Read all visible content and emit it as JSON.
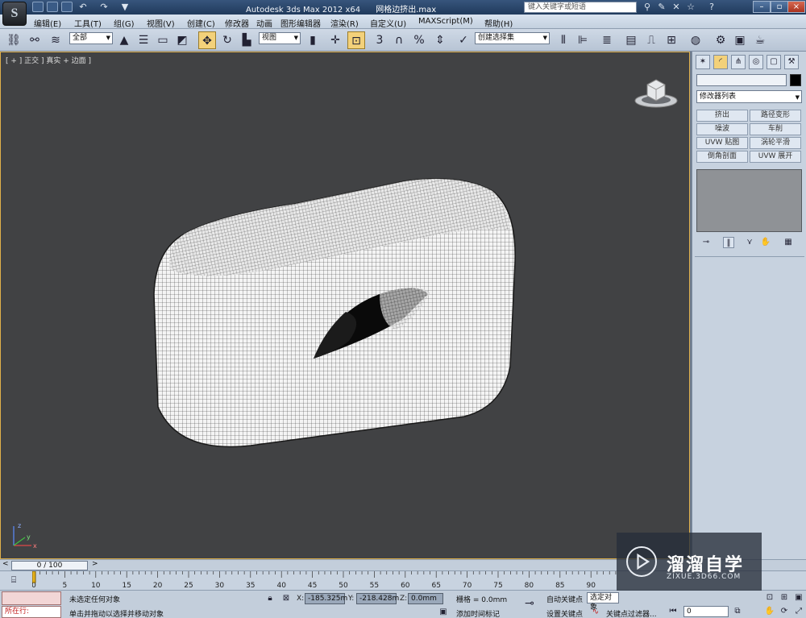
{
  "titlebar": {
    "app_logo": "S",
    "app_title": "Autodesk 3ds Max  2012 x64",
    "file_name": "网格边挤出.max",
    "help_search_placeholder": "键入关键字或短语",
    "workspace_dropdown_arrow": "▼"
  },
  "menubar": {
    "items": [
      "编辑(E)",
      "工具(T)",
      "组(G)",
      "视图(V)",
      "创建(C)",
      "修改器",
      "动画",
      "图形编辑器",
      "渲染(R)",
      "自定义(U)",
      "MAXScript(M)",
      "帮助(H)"
    ]
  },
  "toolbar": {
    "selection_filter": "全部",
    "reference_coord": "视图",
    "snap_label": "3",
    "named_selection_set": "创建选择集"
  },
  "viewport": {
    "label": "[ + ] 正交 ] 真实 + 边面 ]",
    "axis_labels": {
      "x": "x",
      "y": "y",
      "z": "z"
    }
  },
  "command_panel": {
    "modifier_list": "修改器列表",
    "modifier_buttons": [
      "挤出",
      "路径变形",
      "噪波",
      "车削",
      "UVW 贴图",
      "涡轮平滑",
      "倒角剖面",
      "UVW 展开"
    ]
  },
  "timeline": {
    "frame_display": "0 / 100",
    "ticks": [
      "0",
      "5",
      "10",
      "15",
      "20",
      "25",
      "30",
      "35",
      "40",
      "45",
      "50",
      "55",
      "60",
      "65",
      "70",
      "75",
      "80",
      "85",
      "90"
    ]
  },
  "statusbar": {
    "running_label": "所在行:",
    "selection_status": "未选定任何对象",
    "prompt": "单击并拖动以选择并移动对象",
    "x_label": "X:",
    "x_value": "-185.325m",
    "y_label": "Y:",
    "y_value": "-218.428m",
    "z_label": "Z:",
    "z_value": "0.0mm",
    "grid": "栅格 = 0.0mm",
    "add_time_tag": "添加时间标记",
    "auto_key": "自动关键点",
    "set_key": "设置关键点",
    "selected_set": "选定对象",
    "key_filters": "关键点过滤器...",
    "frame_field": "0"
  },
  "watermark": {
    "title": "溜溜自学",
    "url": "ZIXUE.3D66.COM"
  }
}
